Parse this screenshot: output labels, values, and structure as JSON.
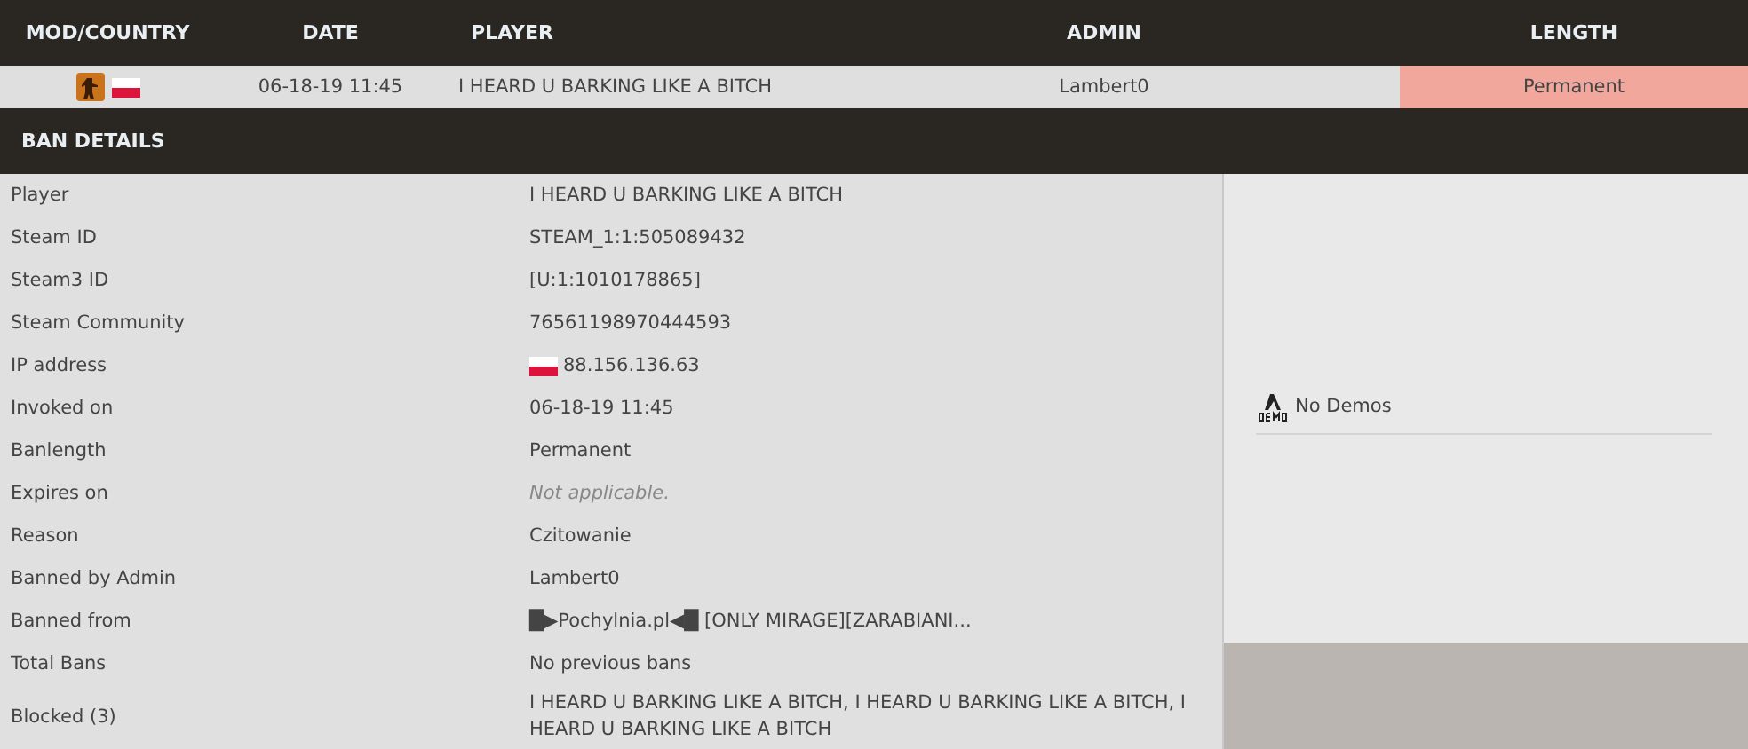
{
  "columns": [
    "MOD/COUNTRY",
    "DATE",
    "PLAYER",
    "ADMIN",
    "LENGTH"
  ],
  "ban": {
    "date": "06-18-19 11:45",
    "player": "I HEARD U BARKING LIKE A BITCH",
    "admin": "Lambert0",
    "length": "Permanent",
    "kind": "permanent"
  },
  "details_title": "BAN DETAILS",
  "details": [
    {
      "label": "Player",
      "value": "I HEARD U BARKING LIKE A BITCH",
      "kind": "text"
    },
    {
      "label": "Steam ID",
      "value": "STEAM_1:1:505089432",
      "kind": "text"
    },
    {
      "label": "Steam3 ID",
      "value": "[U:1:1010178865]",
      "kind": "text"
    },
    {
      "label": "Steam Community",
      "value": "76561198970444593",
      "kind": "text"
    },
    {
      "label": "IP address",
      "value": "88.156.136.63",
      "kind": "flag"
    },
    {
      "label": "Invoked on",
      "value": "06-18-19 11:45",
      "kind": "text"
    },
    {
      "label": "Banlength",
      "value": "Permanent",
      "kind": "text"
    },
    {
      "label": "Expires on",
      "value": "Not applicable.",
      "kind": "muted"
    },
    {
      "label": "Reason",
      "value": "Czitowanie",
      "kind": "text"
    },
    {
      "label": "Banned by Admin",
      "value": "Lambert0",
      "kind": "text"
    },
    {
      "label": "Banned from",
      "value": "█▶Pochylnia.pl◀█ [ONLY MIRAGE][ZARABIANI...",
      "kind": "text"
    },
    {
      "label": "Total Bans",
      "value": "No previous bans",
      "kind": "text"
    },
    {
      "label": "Blocked (3)",
      "value": "I HEARD U BARKING LIKE A BITCH, I HEARD U BARKING LIKE A BITCH, I HEARD U BARKING LIKE A BITCH",
      "kind": "text"
    }
  ],
  "demos": "No Demos"
}
